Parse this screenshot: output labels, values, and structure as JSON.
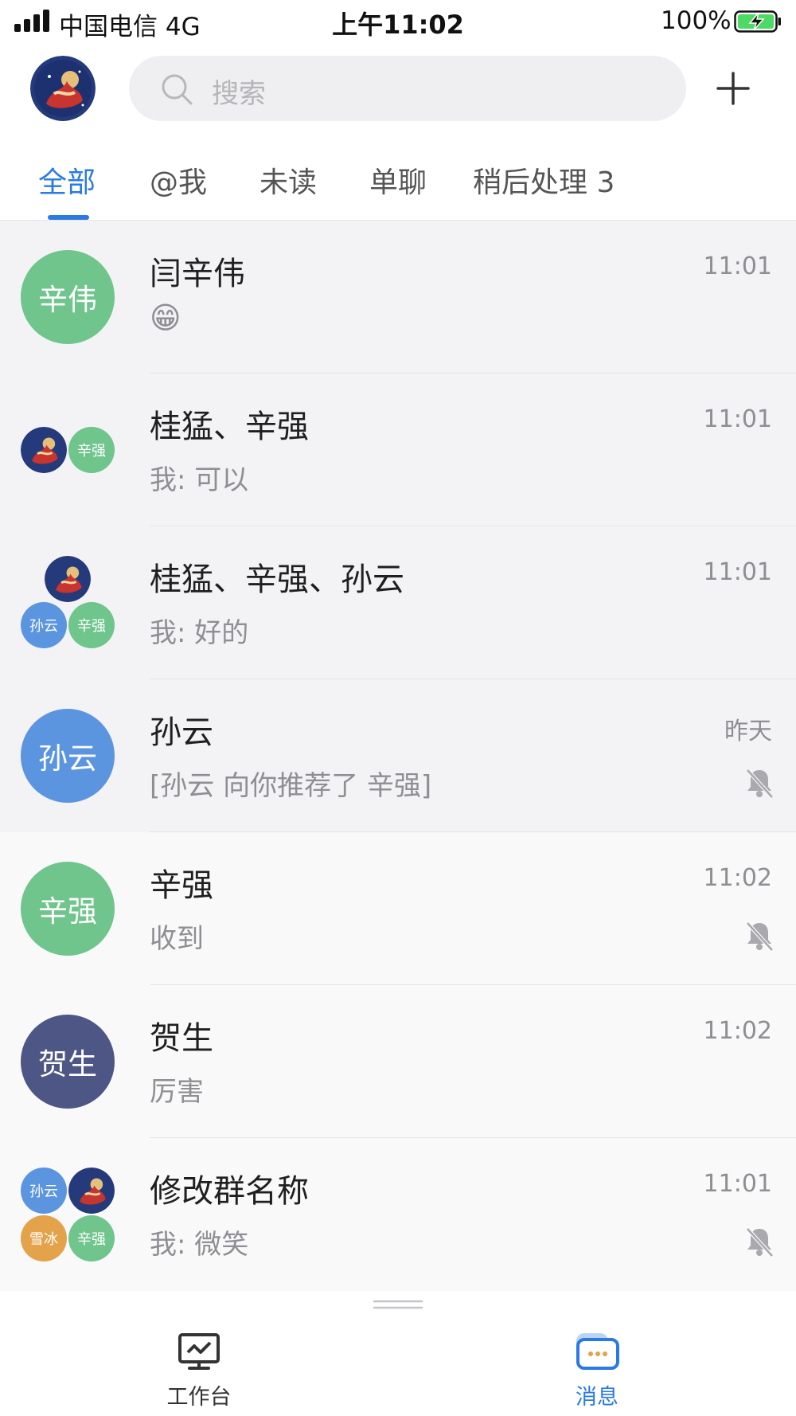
{
  "status_bar": {
    "carrier": "中国电信  4G",
    "time": "上午11:02",
    "battery_pct": "100%"
  },
  "header": {
    "search_placeholder": "搜索"
  },
  "tabs": [
    {
      "label": "全部",
      "active": true
    },
    {
      "label": "@我",
      "active": false
    },
    {
      "label": "未读",
      "active": false
    },
    {
      "label": "单聊",
      "active": false
    },
    {
      "label": "稍后处理 3",
      "active": false
    }
  ],
  "conversations": [
    {
      "title": "闫辛伟",
      "subtitle": "😁",
      "time": "11:01",
      "muted": false,
      "avatar": [
        "辛伟"
      ],
      "pinned": true
    },
    {
      "title": "桂猛、辛强",
      "subtitle": "我: 可以",
      "time": "11:01",
      "muted": false,
      "avatar": [
        "photo",
        "辛强"
      ],
      "pinned": true
    },
    {
      "title": "桂猛、辛强、孙云",
      "subtitle": "我: 好的",
      "time": "11:01",
      "muted": false,
      "avatar": [
        "photo",
        "孙云",
        "辛强"
      ],
      "pinned": true
    },
    {
      "title": "孙云",
      "subtitle": "[孙云 向你推荐了 辛强]",
      "time": "昨天",
      "muted": true,
      "avatar": [
        "孙云"
      ],
      "pinned": true
    },
    {
      "title": "辛强",
      "subtitle": "收到",
      "time": "11:02",
      "muted": true,
      "avatar": [
        "辛强"
      ],
      "pinned": false
    },
    {
      "title": "贺生",
      "subtitle": "厉害",
      "time": "11:02",
      "muted": false,
      "avatar": [
        "贺生"
      ],
      "pinned": false
    },
    {
      "title": "修改群名称",
      "subtitle": "我: 微笑",
      "time": "11:01",
      "muted": true,
      "avatar": [
        "孙云",
        "photo",
        "雪冰",
        "辛强"
      ],
      "pinned": false
    }
  ],
  "tabbar": [
    {
      "label": "工作台",
      "icon": "workbench-icon",
      "active": false
    },
    {
      "label": "消息",
      "icon": "message-icon",
      "active": true
    }
  ],
  "colors": {
    "accent": "#2a7ae2",
    "green": "#6fc58c",
    "blue": "#5b95e0",
    "navy": "#4d5685",
    "orange": "#e4a24b"
  }
}
